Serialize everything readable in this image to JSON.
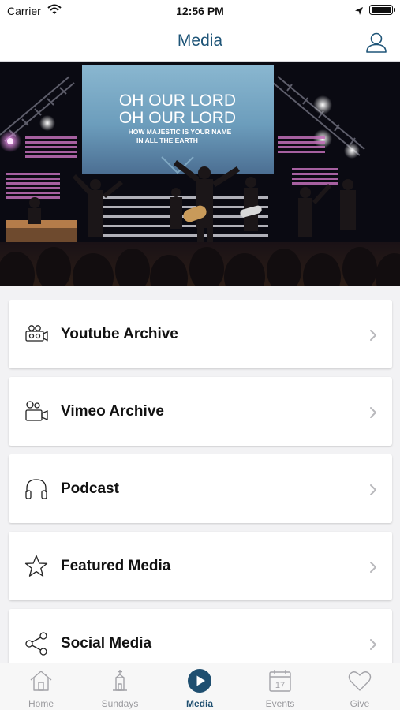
{
  "status_bar": {
    "carrier": "Carrier",
    "time": "12:56 PM"
  },
  "nav": {
    "title": "Media"
  },
  "hero": {
    "screen_line1": "OH OUR LORD",
    "screen_line2": "OH OUR LORD",
    "screen_line3": "HOW MAJESTIC IS YOUR NAME",
    "screen_line4": "IN ALL THE EARTH"
  },
  "menu": {
    "items": [
      {
        "label": "Youtube Archive",
        "icon": "video-camera-icon"
      },
      {
        "label": "Vimeo Archive",
        "icon": "camcorder-icon"
      },
      {
        "label": "Podcast",
        "icon": "headphones-icon"
      },
      {
        "label": "Featured Media",
        "icon": "star-icon"
      },
      {
        "label": "Social Media",
        "icon": "share-icon"
      }
    ]
  },
  "tabs": {
    "items": [
      {
        "label": "Home",
        "icon": "home-icon"
      },
      {
        "label": "Sundays",
        "icon": "church-icon"
      },
      {
        "label": "Media",
        "icon": "play-icon",
        "active": true
      },
      {
        "label": "Events",
        "icon": "calendar-icon",
        "icon_text": "17"
      },
      {
        "label": "Give",
        "icon": "heart-icon"
      }
    ]
  },
  "colors": {
    "accent": "#1f5578",
    "tab_active": "#1f4f70",
    "tab_inactive": "#9b9b9f",
    "background": "#f2f2f4"
  }
}
